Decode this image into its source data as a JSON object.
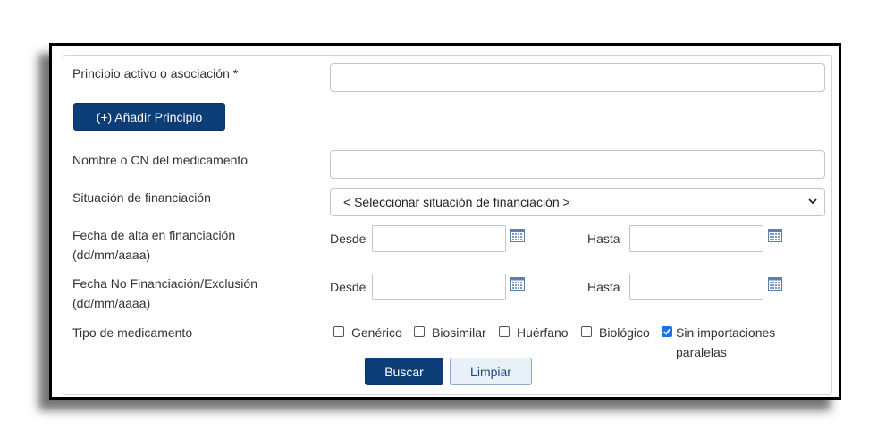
{
  "form": {
    "principio": {
      "label": "Principio activo o asociación *",
      "value": ""
    },
    "add_button": "(+) Añadir Principio",
    "nombre": {
      "label": "Nombre o CN del medicamento",
      "value": ""
    },
    "situacion": {
      "label": "Situación de financiación",
      "selected": "< Seleccionar situación de financiación >"
    },
    "fecha_alta": {
      "label_line1": "Fecha de alta en financiación",
      "label_line2": "(dd/mm/aaaa)",
      "desde_label": "Desde",
      "hasta_label": "Hasta",
      "desde_value": "",
      "hasta_value": ""
    },
    "fecha_no_fin": {
      "label_line1": "Fecha No Financiación/Exclusión",
      "label_line2": "(dd/mm/aaaa)",
      "desde_label": "Desde",
      "hasta_label": "Hasta",
      "desde_value": "",
      "hasta_value": ""
    },
    "tipo": {
      "label": "Tipo de medicamento",
      "options": [
        {
          "label": "Genérico",
          "checked": false
        },
        {
          "label": "Biosimilar",
          "checked": false
        },
        {
          "label": "Huérfano",
          "checked": false
        },
        {
          "label": "Biológico",
          "checked": false
        },
        {
          "label_line1": "Sin importaciones",
          "label_line2": "paralelas",
          "checked": true
        }
      ]
    },
    "buscar": "Buscar",
    "limpiar": "Limpiar"
  },
  "colors": {
    "primary": "#0c3d77",
    "secondary": "#e8f0f8",
    "checkbox_checked": "#1a73e8"
  },
  "icons": [
    "calendar-icon",
    "chevron-down-icon",
    "checkmark-icon"
  ]
}
